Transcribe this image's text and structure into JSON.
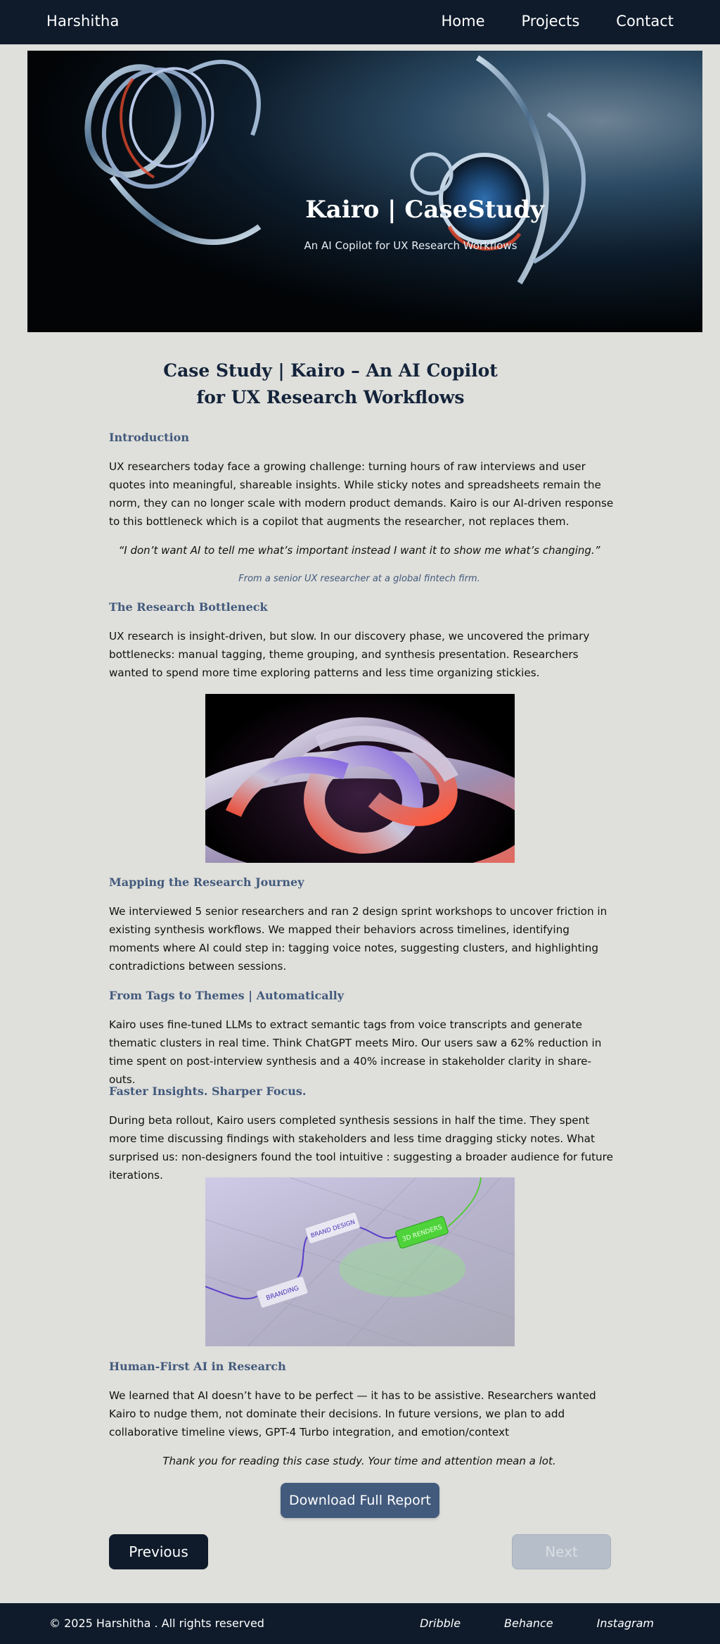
{
  "nav": {
    "brand": "Harshitha",
    "links": [
      "Home",
      "Projects",
      "Contact"
    ]
  },
  "hero": {
    "title": "Kairo | CaseStudy",
    "subtitle": "An AI Copilot for UX Research Workflows"
  },
  "page_title": "Case Study | Kairo – An AI Copilot for UX Research Workflows",
  "sections": {
    "intro": {
      "heading": "Introduction",
      "body": "UX researchers today face a growing challenge: turning hours of raw interviews and user quotes into meaningful, shareable insights. While sticky notes and spreadsheets remain the norm, they can no longer scale with modern product demands. Kairo is our AI-driven response to this bottleneck which is a copilot that augments the researcher, not replaces them.",
      "quote": "“I don’t want AI to tell me what’s important instead I want it to show me what’s changing.”",
      "source": "From a senior UX researcher at a global fintech firm."
    },
    "bottleneck": {
      "heading": "The Research Bottleneck",
      "body": "UX research is insight-driven, but slow. In our discovery phase, we uncovered the primary bottlenecks: manual tagging, theme grouping, and synthesis presentation. Researchers wanted to spend more time exploring patterns and less time organizing stickies."
    },
    "journey": {
      "heading": "Mapping the Research Journey",
      "body": "We interviewed 5 senior researchers and ran 2 design sprint workshops to uncover friction in existing synthesis workflows. We mapped their behaviors across timelines, identifying moments where AI could step in: tagging voice notes, suggesting clusters, and highlighting contradictions between sessions."
    },
    "tags": {
      "heading": "From Tags to Themes | Automatically",
      "body": "Kairo uses fine-tuned LLMs to extract semantic tags from voice transcripts and generate thematic clusters in real time. Think ChatGPT meets Miro. Our users saw a 62% reduction in time spent on post-interview synthesis and a 40% increase in stakeholder clarity in share-outs."
    },
    "insights": {
      "heading": "Faster Insights. Sharper Focus.",
      "body": "During beta rollout, Kairo users completed synthesis sessions in half the time. They spent more time discussing findings with stakeholders and less time dragging sticky notes. What surprised us: non-designers found the tool intuitive : suggesting a broader audience for future iterations."
    },
    "human": {
      "heading": "Human-First AI in Research",
      "body": "We learned that AI doesn’t have to be perfect — it has to be assistive. Researchers wanted Kairo to nudge them, not dominate their decisions. In future versions, we plan to add collaborative timeline views, GPT-4 Turbo integration, and emotion/context"
    }
  },
  "figure2_labels": [
    "BRAND DESIGN",
    "3D RENDERS",
    "BRANDING"
  ],
  "thanks": "Thank you for reading this case study. Your time and attention mean a lot.",
  "buttons": {
    "download": "Download Full Report",
    "previous": "Previous",
    "next": "Next"
  },
  "footer": {
    "copyright": "© 2025 Harshitha . All rights reserved",
    "social": [
      "Dribble",
      "Behance",
      "Instagram"
    ]
  },
  "colors": {
    "navy": "#0f1b2b",
    "accent": "#425a7c",
    "background": "#dfdfdb"
  }
}
